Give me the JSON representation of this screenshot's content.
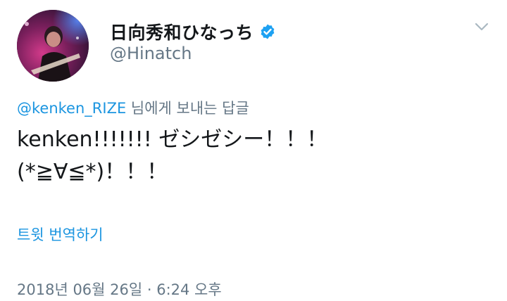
{
  "user": {
    "display_name": "日向秀和ひなっち",
    "handle": "@Hinatch",
    "verified": true,
    "avatar_icon": "profile-photo"
  },
  "reply": {
    "mention": "@kenken_RIZE",
    "suffix": " 님에게 보내는 답글"
  },
  "tweet": {
    "text": "kenken!!!!!!! ゼシゼシー！！！\n(*≧∀≦*)！！！"
  },
  "translate_label": "트윗 번역하기",
  "timestamp": "2018년 06월 26일 · 6:24 오후",
  "colors": {
    "link": "#1b95e0",
    "secondary_text": "#657786",
    "primary_text": "#14171a",
    "verified_badge": "#1da1f2"
  },
  "icons": {
    "verified": "verified-badge-icon",
    "menu": "chevron-down-icon"
  }
}
